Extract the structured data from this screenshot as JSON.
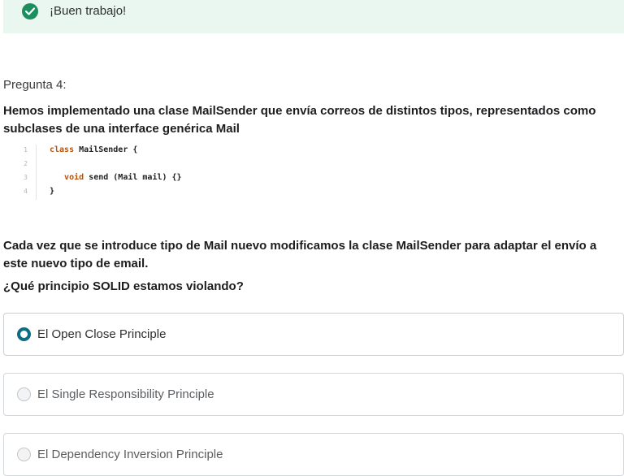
{
  "feedback": {
    "message": "¡Buen trabajo!",
    "icon": "check-circle-icon",
    "color": "#1e8e5f"
  },
  "question": {
    "label": "Pregunta 4:",
    "text": "Hemos implementado una clase MailSender que envía correos de distintos tipos, representados como subclases de una interface genérica Mail",
    "code_lines": [
      {
        "number": "1",
        "keyword": "class",
        "rest": " MailSender {"
      },
      {
        "number": "2",
        "keyword": "",
        "rest": ""
      },
      {
        "number": "3",
        "keyword": "   void",
        "rest": " send (Mail mail) {}"
      },
      {
        "number": "4",
        "keyword": "",
        "rest": "}"
      }
    ],
    "context": "Cada vez que se introduce tipo de Mail nuevo modificamos la clase MailSender para adaptar el envío a este nuevo tipo de email.",
    "prompt": "¿Qué principio SOLID estamos violando?"
  },
  "options": [
    {
      "label": "El Open Close Principle",
      "selected": true
    },
    {
      "label": "El Single Responsibility Principle",
      "selected": false
    },
    {
      "label": "El Dependency Inversion Principle",
      "selected": false
    }
  ]
}
